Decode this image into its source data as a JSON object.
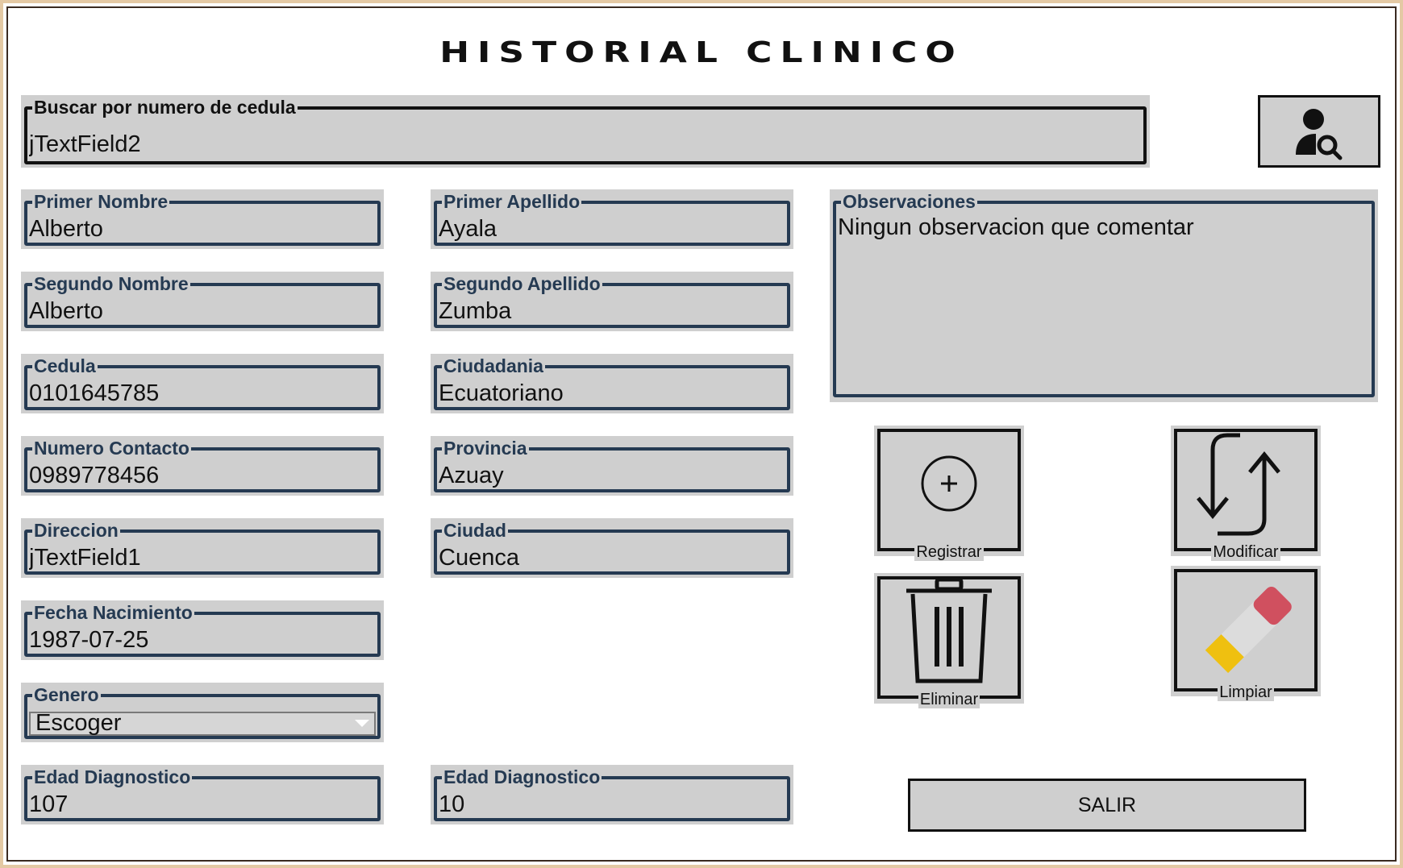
{
  "title": "HISTORIAL CLINICO",
  "search": {
    "label": "Buscar por numero de cedula",
    "value": "jTextField2",
    "button_icon": "user-search-icon"
  },
  "fields": {
    "primer_nombre": {
      "label": "Primer Nombre",
      "value": "Alberto"
    },
    "primer_apellido": {
      "label": "Primer Apellido",
      "value": "Ayala"
    },
    "segundo_nombre": {
      "label": "Segundo Nombre",
      "value": "Alberto"
    },
    "segundo_apellido": {
      "label": "Segundo Apellido",
      "value": "Zumba"
    },
    "cedula": {
      "label": "Cedula",
      "value": "0101645785"
    },
    "ciudadania": {
      "label": "Ciudadania",
      "value": "Ecuatoriano"
    },
    "numero_contacto": {
      "label": "Numero Contacto",
      "value": "0989778456"
    },
    "provincia": {
      "label": "Provincia",
      "value": "Azuay"
    },
    "direccion": {
      "label": "Direccion",
      "value": "jTextField1"
    },
    "ciudad": {
      "label": "Ciudad",
      "value": "Cuenca"
    },
    "fecha_nacimiento": {
      "label": "Fecha Nacimiento",
      "value": "1987-07-25"
    },
    "genero": {
      "label": "Genero",
      "value": "Escoger"
    },
    "edad_diagnostico_1": {
      "label": "Edad Diagnostico",
      "value": "107"
    },
    "edad_diagnostico_2": {
      "label": "Edad Diagnostico",
      "value": "10"
    }
  },
  "observaciones": {
    "label": "Observaciones",
    "value": "Ningun observacion que comentar"
  },
  "actions": {
    "registrar": {
      "label": "Registrar",
      "icon": "plus-circle-icon"
    },
    "modificar": {
      "label": "Modificar",
      "icon": "swap-arrows-icon"
    },
    "eliminar": {
      "label": "Eliminar",
      "icon": "trash-icon"
    },
    "limpiar": {
      "label": "Limpiar",
      "icon": "eraser-icon"
    }
  },
  "salir": {
    "label": "SALIR"
  },
  "colors": {
    "field_border": "#253a52",
    "field_bg": "#cfcfcf",
    "frame": "#e4c9a4",
    "eraser_red": "#d0505f",
    "eraser_yellow": "#efc010"
  }
}
